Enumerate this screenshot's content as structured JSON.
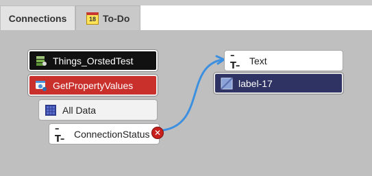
{
  "tabs": [
    {
      "label": "Connections",
      "active": true
    },
    {
      "label": "To-Do",
      "icon": "calendar-icon",
      "icon_number": "18"
    }
  ],
  "nodes": {
    "things": {
      "label": "Things_OrstedTest",
      "icon": "thing-icon"
    },
    "getprop": {
      "label": "GetPropertyValues",
      "icon": "service-icon"
    },
    "alldata": {
      "label": "All Data",
      "icon": "grid-icon"
    },
    "connstatus": {
      "label": "ConnectionStatus",
      "icon": "text-type-icon"
    },
    "text": {
      "label": "Text",
      "icon": "text-type-icon"
    },
    "label": {
      "label": "label-17",
      "icon": "label-widget-icon"
    }
  },
  "connection": {
    "from": "ConnectionStatus",
    "to": "Text",
    "color": "#3d8fe0"
  },
  "colors": {
    "thing": "#111111",
    "service": "#c9302c",
    "label_widget": "#2e3363",
    "remove": "#c8201c"
  }
}
